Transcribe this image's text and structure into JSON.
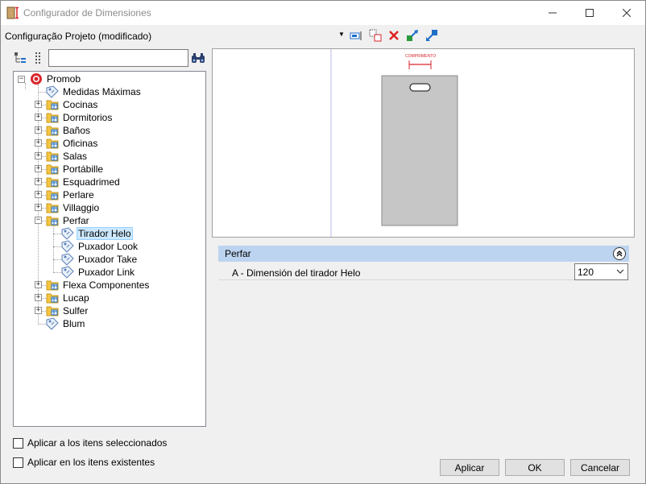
{
  "window": {
    "title": "Configurador de Dimensiones"
  },
  "header": {
    "project_title": "Configuração Projeto (modificado)"
  },
  "search": {
    "value": "",
    "placeholder": ""
  },
  "tree": {
    "root": "Promob",
    "items": [
      "Medidas Máximas",
      "Cocinas",
      "Dormitorios",
      "Baños",
      "Oficinas",
      "Salas",
      "Portábille",
      "Esquadrimed",
      "Perlare",
      "Villaggio",
      "Perfar",
      "Tirador Helo",
      "Puxador Look",
      "Puxador Take",
      "Puxador Link",
      "Flexa Componentes",
      "Lucap",
      "Sulfer",
      "Blum"
    ]
  },
  "preview": {
    "dimension_label": "COMPRIMENTO"
  },
  "properties": {
    "group_label": "Perfar",
    "row_label": "A - Dimensión del tirador Helo",
    "row_value": "120"
  },
  "options": {
    "apply_selected": "Aplicar a los itens seleccionados",
    "apply_existing": "Aplicar en los itens existentes"
  },
  "buttons": {
    "apply": "Aplicar",
    "ok": "OK",
    "cancel": "Cancelar"
  },
  "colors": {
    "accent_header": "#bcd4f0",
    "selection": "#cce8ff",
    "delete_red": "#e02020",
    "dimension_red": "#d9262c",
    "folder_yellow": "#f4c542"
  }
}
